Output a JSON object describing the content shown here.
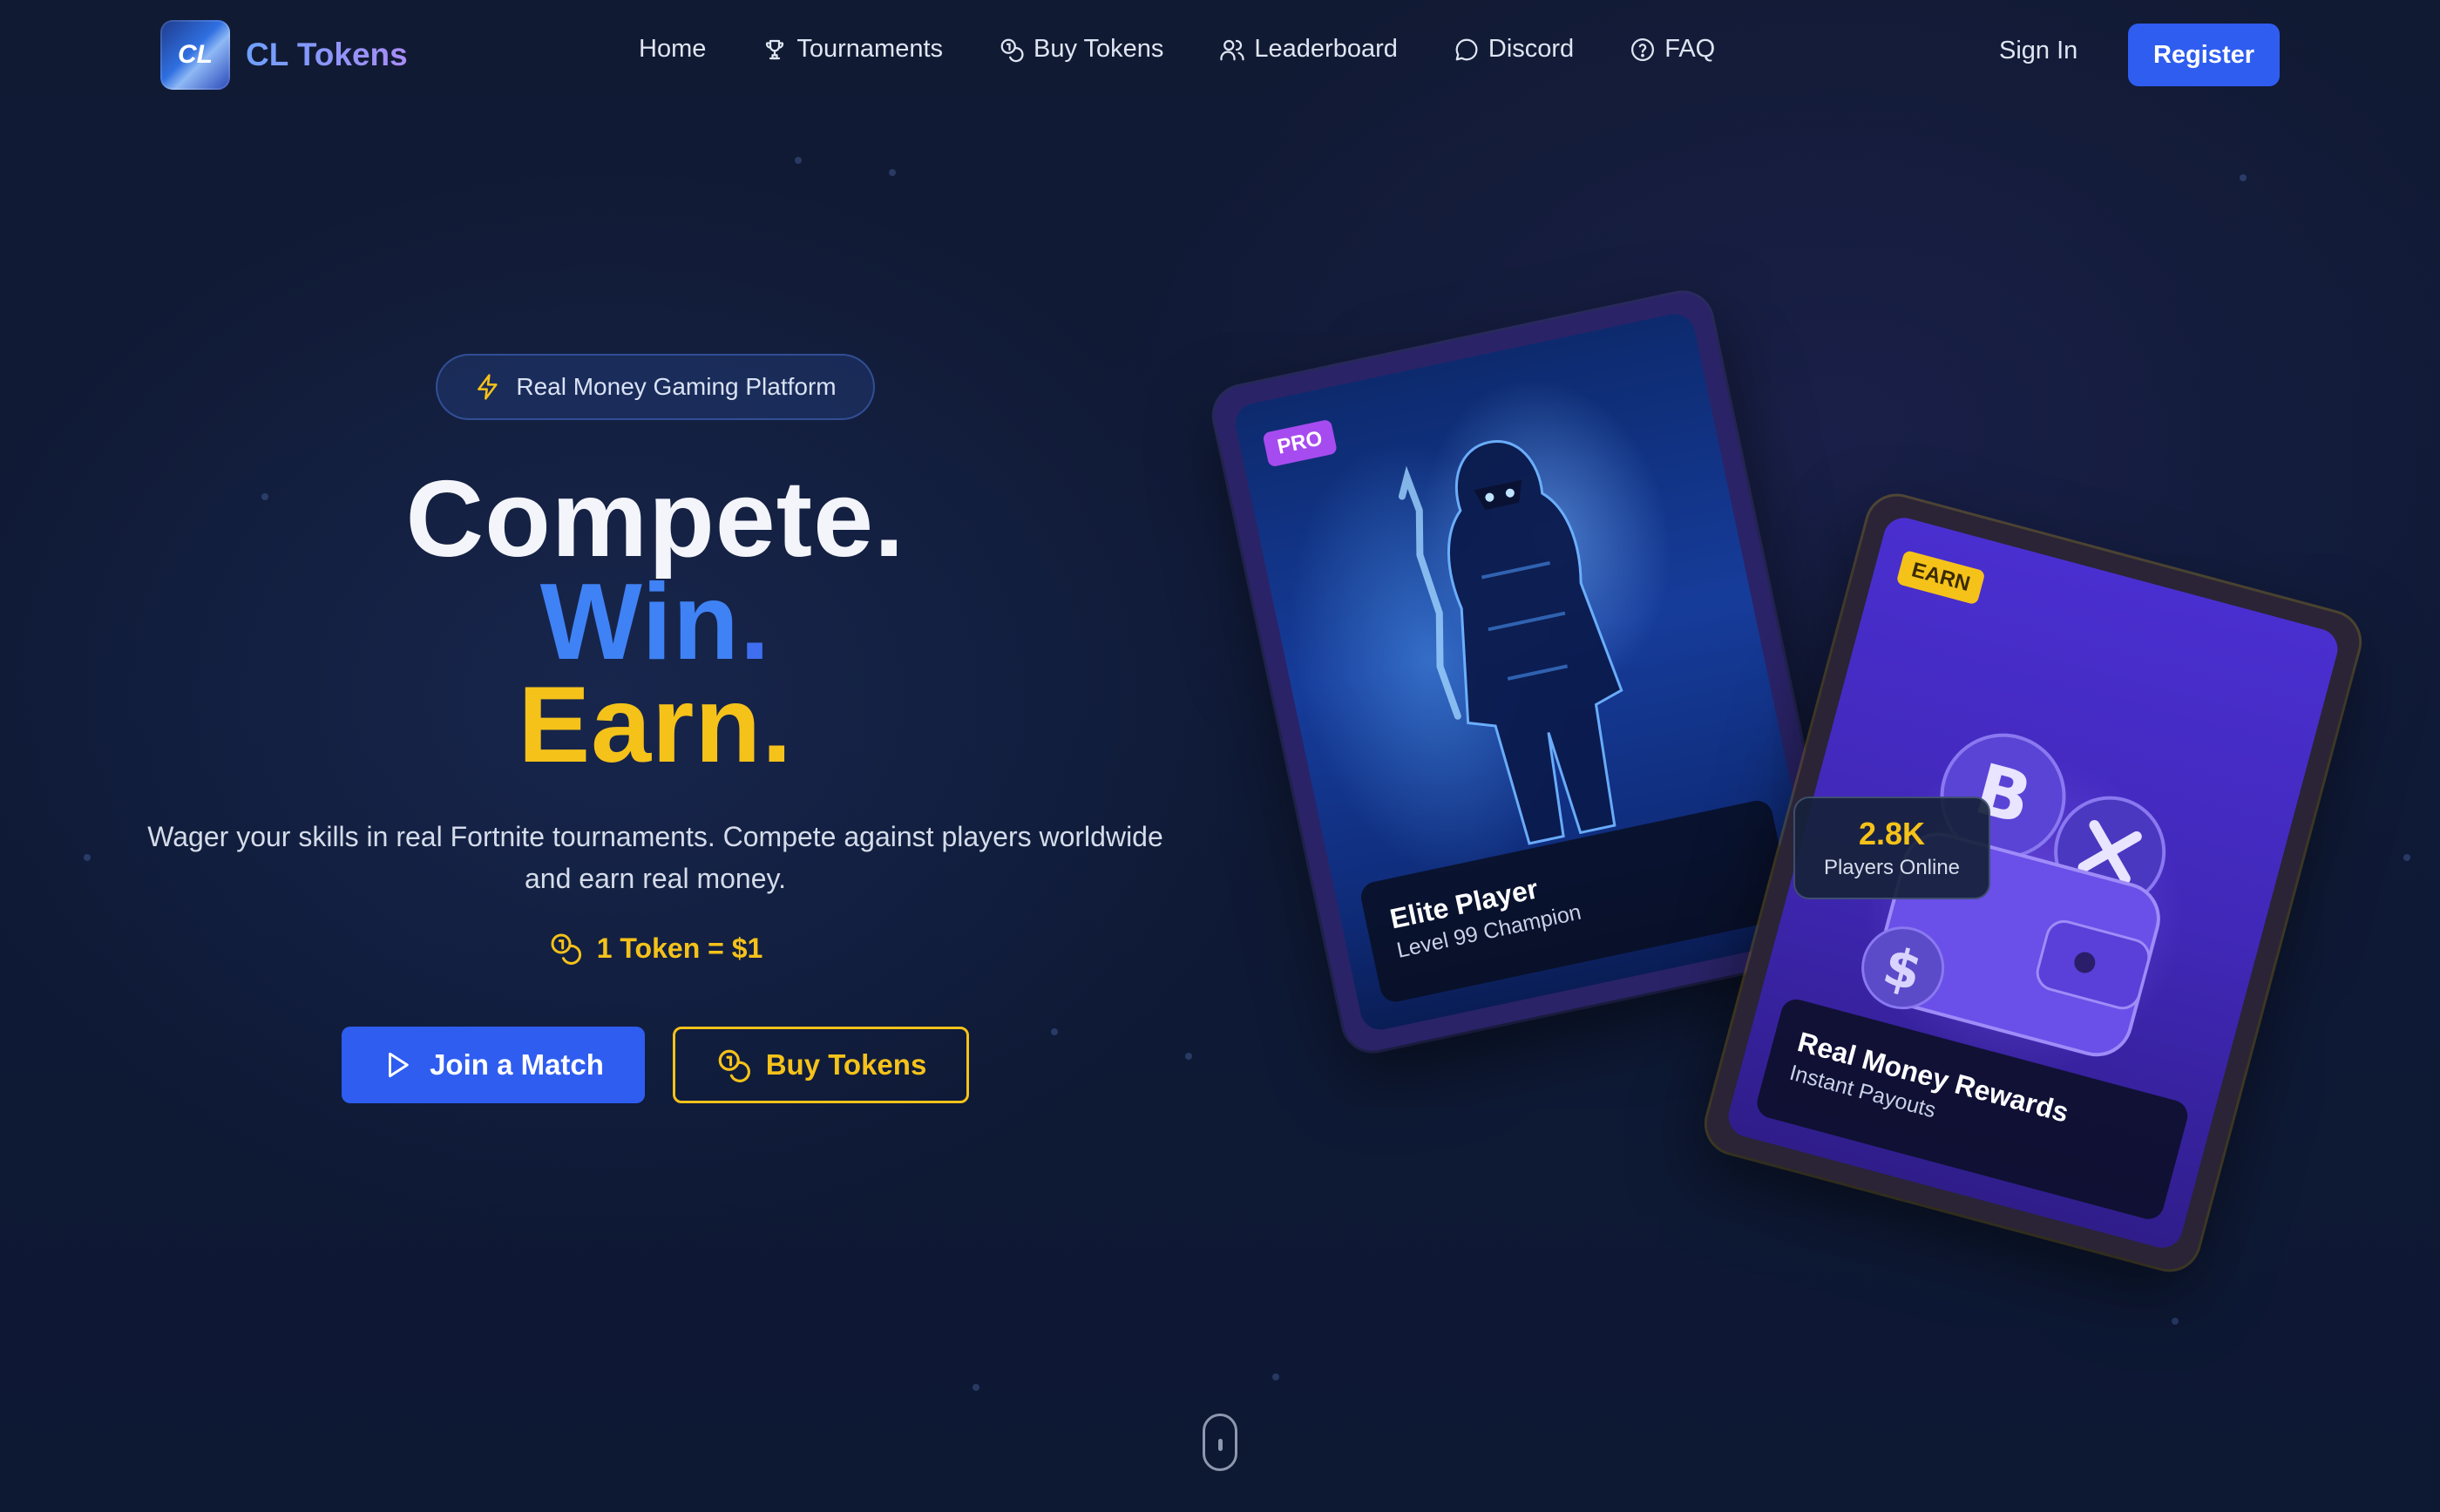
{
  "nav": {
    "brand": {
      "logo_text": "CL",
      "name": "CL Tokens"
    },
    "links": [
      {
        "label": "Home",
        "icon": "none"
      },
      {
        "label": "Tournaments",
        "icon": "trophy-icon"
      },
      {
        "label": "Buy Tokens",
        "icon": "coins-icon"
      },
      {
        "label": "Leaderboard",
        "icon": "users-icon"
      },
      {
        "label": "Discord",
        "icon": "chat-bubble-icon"
      },
      {
        "label": "FAQ",
        "icon": "help-circle-icon"
      }
    ],
    "sign_in": "Sign In",
    "register": "Register"
  },
  "hero": {
    "badge": "Real Money Gaming Platform",
    "headline": {
      "line1_word": "Compete",
      "line1_period": ".",
      "line2_word": "Win",
      "line2_period": ".",
      "line3_word": "Earn",
      "line3_period": "."
    },
    "subtext": "Wager your skills in real Fortnite tournaments. Compete against players worldwide and earn real money.",
    "rate": "1 Token = $1",
    "primary_button": "Join a Match",
    "secondary_button": "Buy Tokens"
  },
  "cards": [
    {
      "badge": "PRO",
      "title": "Elite Player",
      "subtitle": "Level 99 Champion"
    },
    {
      "badge": "EARN",
      "title": "Real Money Rewards",
      "subtitle": "Instant Payouts"
    }
  ],
  "stat": {
    "value": "2.8K",
    "label": "Players Online"
  },
  "colors": {
    "background": "#0f1a36",
    "accent_blue": "#2f5df0",
    "accent_gold": "#f5c21a",
    "win_blue": "#3f82f5",
    "pro_purple": "#a64bf0"
  }
}
